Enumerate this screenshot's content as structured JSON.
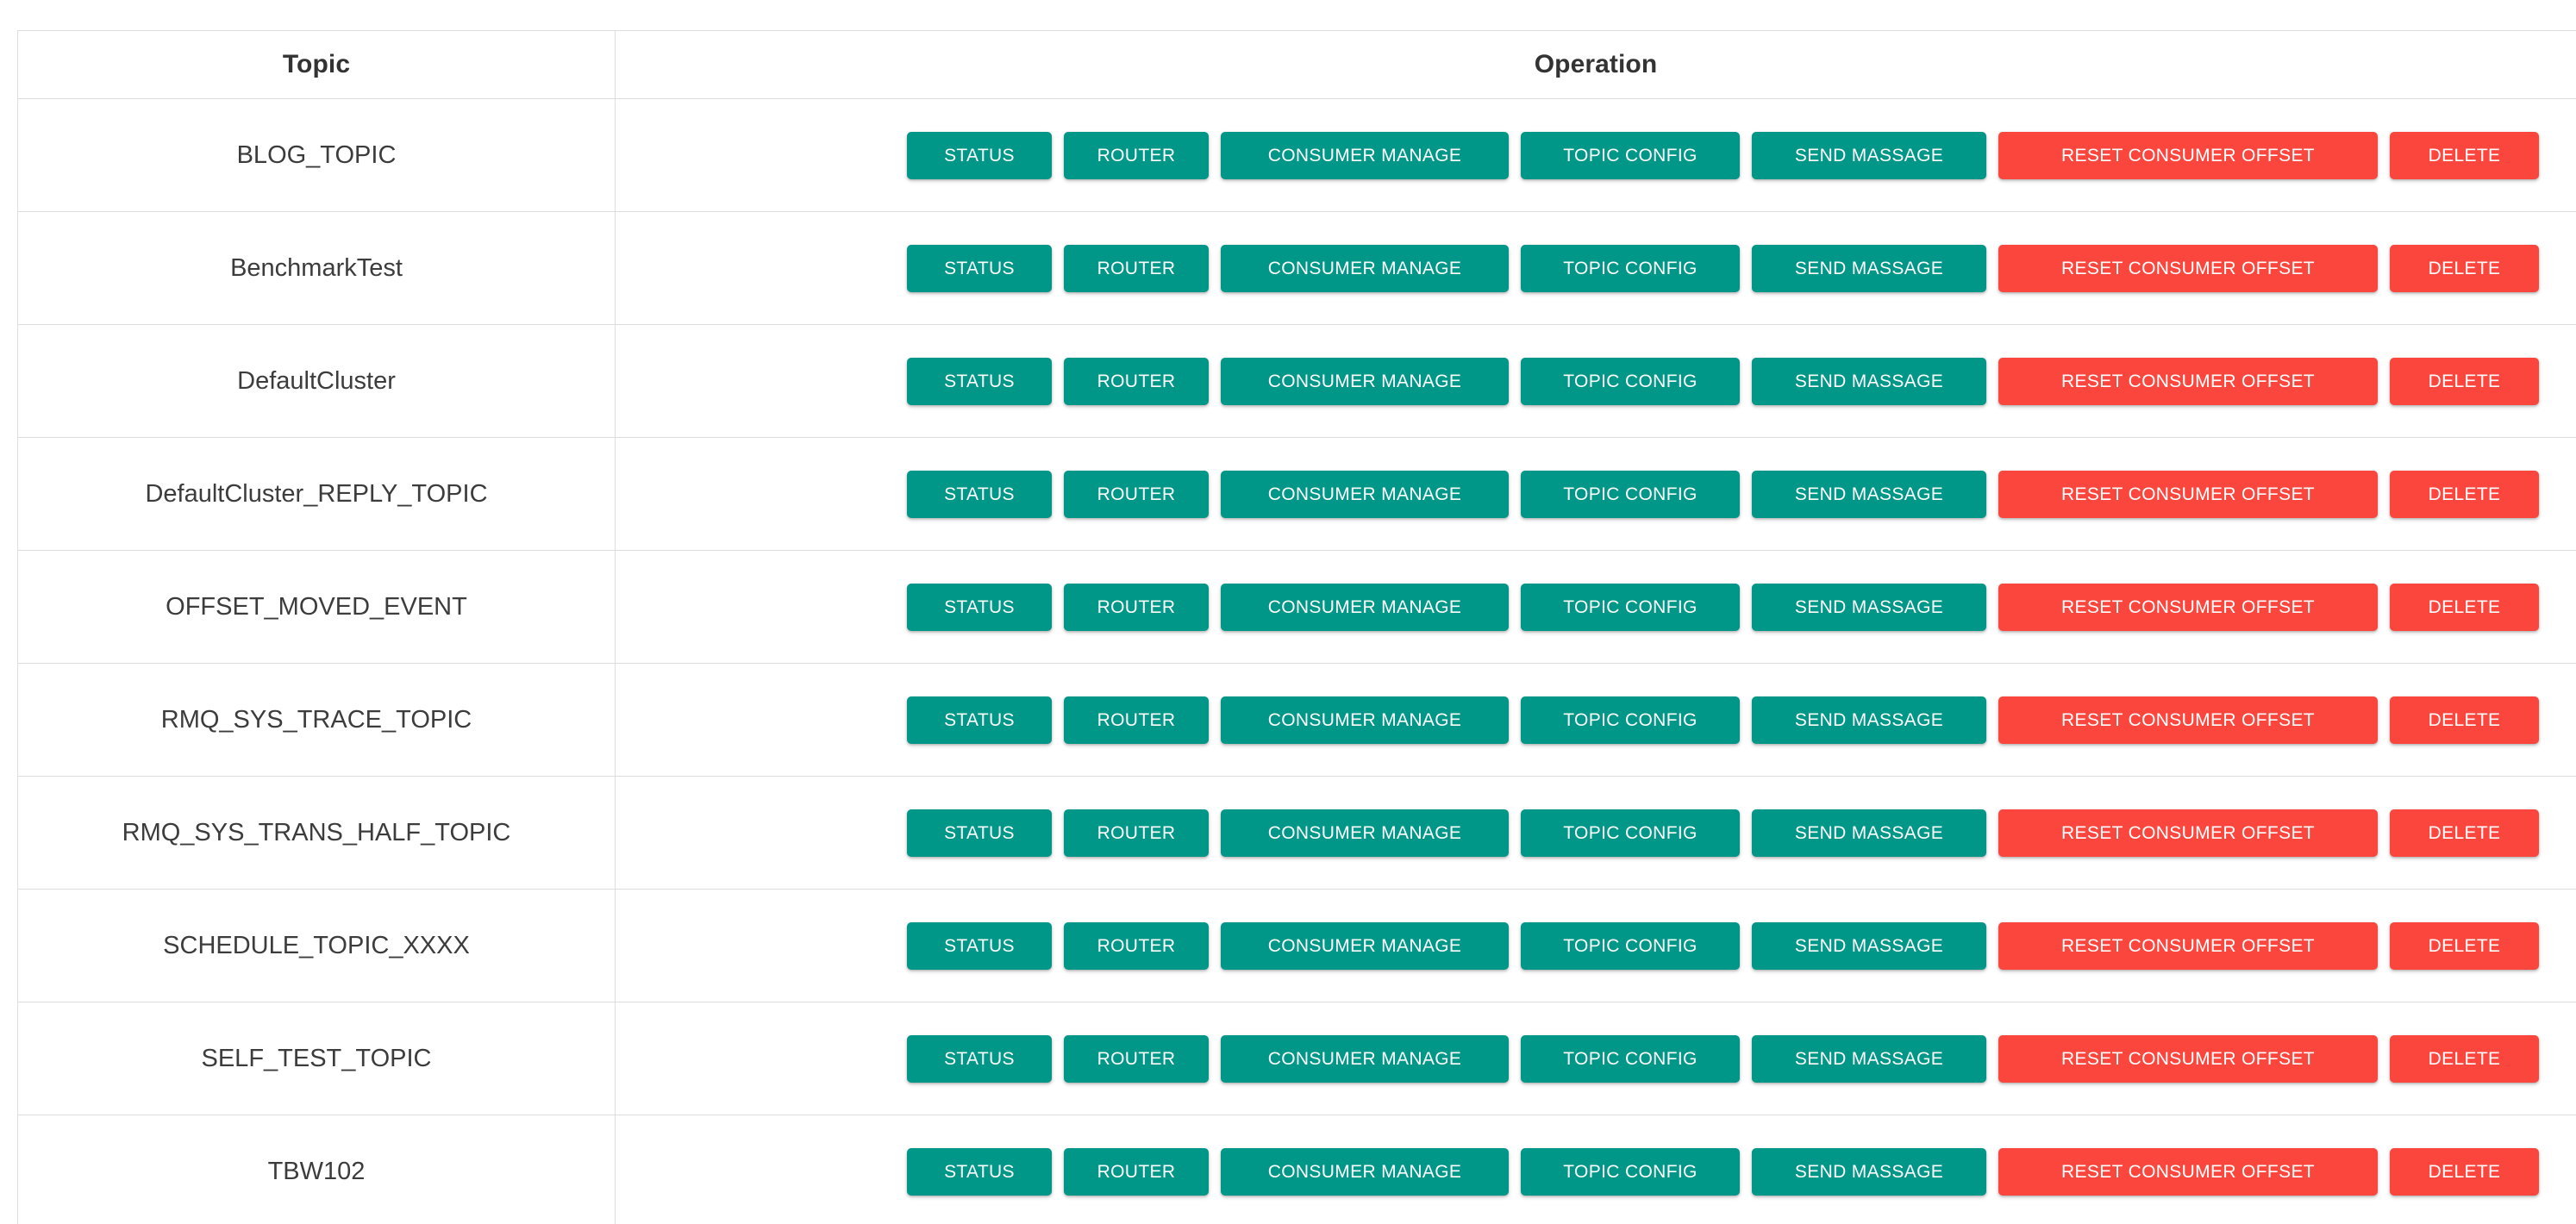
{
  "table": {
    "columns": [
      {
        "key": "topic",
        "label": "Topic"
      },
      {
        "key": "operation",
        "label": "Operation"
      }
    ],
    "header": {
      "topic_label": "Topic",
      "operation_label": "Operation"
    },
    "actions": [
      {
        "key": "status",
        "label": "STATUS",
        "color": "#009688",
        "style": "teal"
      },
      {
        "key": "router",
        "label": "ROUTER",
        "color": "#009688",
        "style": "teal"
      },
      {
        "key": "consumer",
        "label": "CONSUMER MANAGE",
        "color": "#009688",
        "style": "teal"
      },
      {
        "key": "config",
        "label": "TOPIC CONFIG",
        "color": "#009688",
        "style": "teal"
      },
      {
        "key": "send",
        "label": "SEND MASSAGE",
        "color": "#009688",
        "style": "teal"
      },
      {
        "key": "reset",
        "label": "RESET CONSUMER OFFSET",
        "color": "#fb463e",
        "style": "red"
      },
      {
        "key": "delete",
        "label": "DELETE",
        "color": "#fb463e",
        "style": "red"
      }
    ],
    "rows": [
      {
        "topic": "BLOG_TOPIC"
      },
      {
        "topic": "BenchmarkTest"
      },
      {
        "topic": "DefaultCluster"
      },
      {
        "topic": "DefaultCluster_REPLY_TOPIC"
      },
      {
        "topic": "OFFSET_MOVED_EVENT"
      },
      {
        "topic": "RMQ_SYS_TRACE_TOPIC"
      },
      {
        "topic": "RMQ_SYS_TRANS_HALF_TOPIC"
      },
      {
        "topic": "SCHEDULE_TOPIC_XXXX"
      },
      {
        "topic": "SELF_TEST_TOPIC"
      },
      {
        "topic": "TBW102"
      }
    ],
    "row_count": 10
  },
  "theme": {
    "background": "#ffffff",
    "border_color": "#dddddd",
    "header_text_color": "#333333",
    "body_text_color": "#3c3c3c",
    "accent_teal": "#009688",
    "accent_red": "#fb463e",
    "button_text_color": "#ffffff"
  }
}
